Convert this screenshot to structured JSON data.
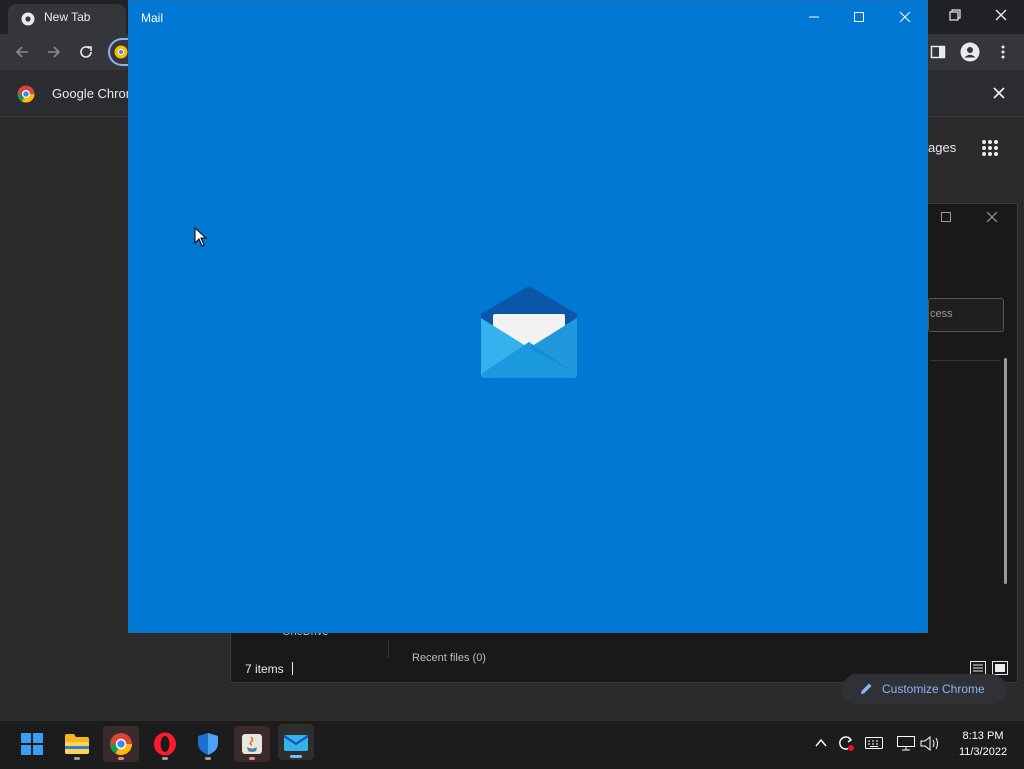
{
  "chrome": {
    "tab_title": "New Tab",
    "infobar_text": "Google Chrome",
    "images_link": "ages",
    "customize_label": "Customize Chrome"
  },
  "explorer": {
    "search_placeholder": "cess",
    "status_text": "7 items",
    "nav_item": "OneDrive",
    "recent_files": "Recent files (0)"
  },
  "mail": {
    "title": "Mail",
    "background_color": "#0078d4"
  },
  "taskbar": {
    "apps": [
      "start-icon",
      "file-explorer-icon",
      "chrome-icon",
      "opera-icon",
      "security-icon",
      "java-icon",
      "mail-icon"
    ],
    "time": "8:13 PM",
    "date": "11/3/2022"
  }
}
